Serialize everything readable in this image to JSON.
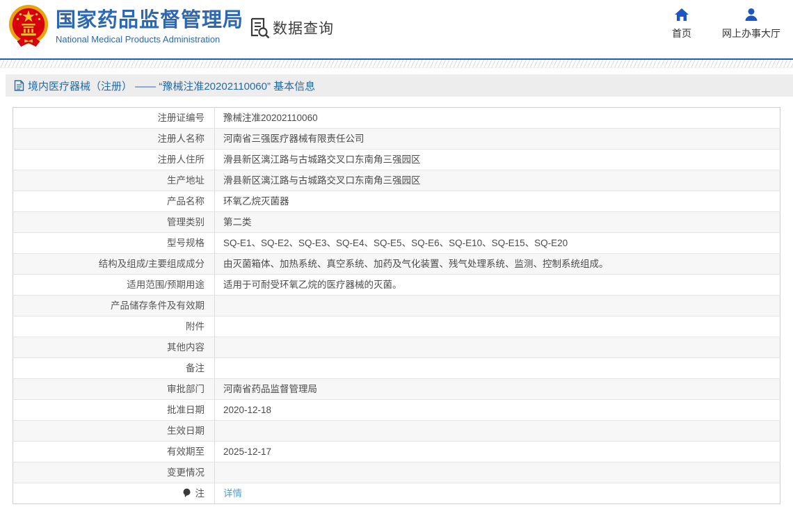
{
  "header": {
    "org_name_zh": "国家药品监督管理局",
    "org_name_en": "National Medical Products Administration",
    "section_label": "数据查询",
    "nav": [
      {
        "label": "首页",
        "icon": "home-icon"
      },
      {
        "label": "网上办事大厅",
        "icon": "user-icon"
      }
    ]
  },
  "page": {
    "title": "境内医疗器械（注册） —— “豫械注准20202110060” 基本信息"
  },
  "table": {
    "rows": [
      {
        "label": "注册证编号",
        "value": "豫械注准20202110060"
      },
      {
        "label": "注册人名称",
        "value": "河南省三强医疗器械有限责任公司"
      },
      {
        "label": "注册人住所",
        "value": "滑县新区漓江路与古城路交叉口东南角三强园区"
      },
      {
        "label": "生产地址",
        "value": "滑县新区漓江路与古城路交叉口东南角三强园区"
      },
      {
        "label": "产品名称",
        "value": "环氧乙烷灭菌器"
      },
      {
        "label": "管理类别",
        "value": "第二类"
      },
      {
        "label": "型号规格",
        "value": "SQ-E1、SQ-E2、SQ-E3、SQ-E4、SQ-E5、SQ-E6、SQ-E10、SQ-E15、SQ-E20"
      },
      {
        "label": "结构及组成/主要组成成分",
        "value": "由灭菌箱体、加热系统、真空系统、加药及气化装置、残气处理系统、监测、控制系统组成。"
      },
      {
        "label": "适用范围/预期用途",
        "value": "适用于可耐受环氧乙烷的医疗器械的灭菌。"
      },
      {
        "label": "产品储存条件及有效期",
        "value": ""
      },
      {
        "label": "附件",
        "value": ""
      },
      {
        "label": "其他内容",
        "value": ""
      },
      {
        "label": "备注",
        "value": ""
      },
      {
        "label": "审批部门",
        "value": "河南省药品监督管理局"
      },
      {
        "label": "批准日期",
        "value": "2020-12-18"
      },
      {
        "label": "生效日期",
        "value": ""
      },
      {
        "label": "有效期至",
        "value": "2025-12-17"
      },
      {
        "label": "变更情况",
        "value": ""
      },
      {
        "label": "注",
        "value": "详情",
        "link": true,
        "label_icon": "note-icon"
      }
    ]
  },
  "colors": {
    "brand_blue": "#2e67b1",
    "separator_blue": "#1e5faf",
    "title_blue": "#2569a8",
    "link_blue": "#4aa0e8",
    "nav_icon_blue": "#1d56c0",
    "emblem_red": "#d7000f",
    "emblem_gold": "#e8a30e",
    "row_alt_bg": "#f7f7f7",
    "title_bar_bg": "#ededed"
  }
}
